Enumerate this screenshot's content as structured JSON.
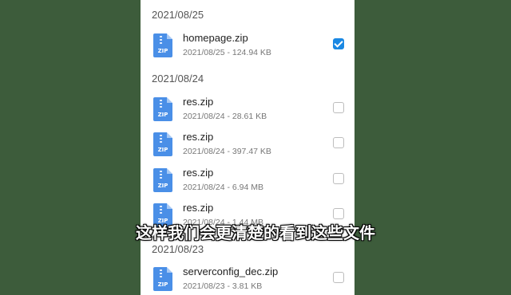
{
  "groups": [
    {
      "date": "2021/08/25",
      "files": [
        {
          "name": "homepage.zip",
          "meta": "2021/08/25 - 124.94 KB",
          "checked": true
        }
      ]
    },
    {
      "date": "2021/08/24",
      "files": [
        {
          "name": "res.zip",
          "meta": "2021/08/24 - 28.61 KB",
          "checked": false
        },
        {
          "name": "res.zip",
          "meta": "2021/08/24 - 397.47 KB",
          "checked": false
        },
        {
          "name": "res.zip",
          "meta": "2021/08/24 - 6.94 MB",
          "checked": false
        },
        {
          "name": "res.zip",
          "meta": "2021/08/24 - 1.44 MB",
          "checked": false
        }
      ]
    },
    {
      "date": "2021/08/23",
      "files": [
        {
          "name": "serverconfig_dec.zip",
          "meta": "2021/08/23 - 3.81 KB",
          "checked": false
        }
      ]
    }
  ],
  "icon": {
    "name": "zip-file-icon",
    "label": "ZIP"
  },
  "subtitle": "这样我们会更清楚的看到这些文件",
  "colors": {
    "accent": "#1a88e3",
    "zip_icon": "#4a8fe7",
    "background": "#3d5c3b"
  }
}
